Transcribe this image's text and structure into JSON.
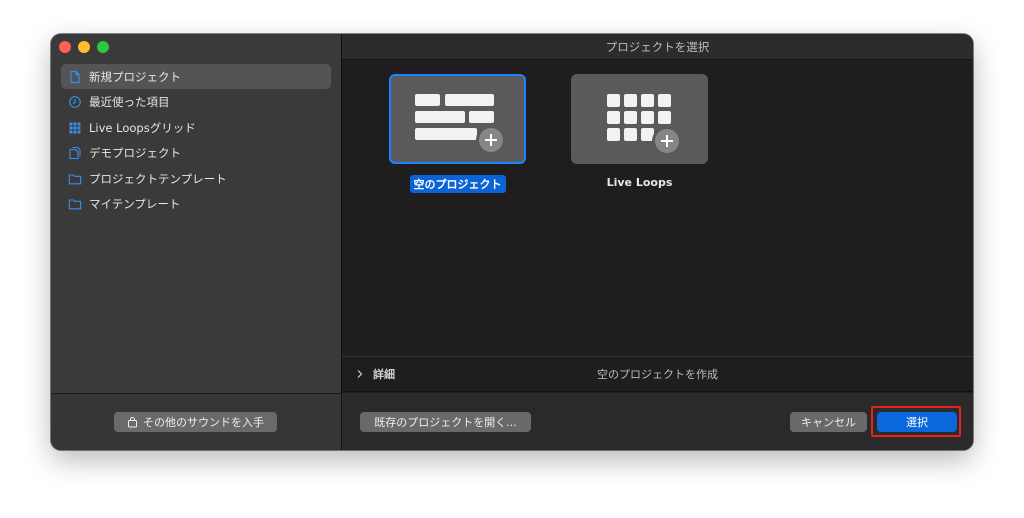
{
  "window": {
    "title": "プロジェクトを選択"
  },
  "sidebar": {
    "items": [
      {
        "label": "新規プロジェクト",
        "icon": "document-icon"
      },
      {
        "label": "最近使った項目",
        "icon": "clock-icon"
      },
      {
        "label": "Live Loopsグリッド",
        "icon": "grid-icon"
      },
      {
        "label": "デモプロジェクト",
        "icon": "documents-icon"
      },
      {
        "label": "プロジェクトテンプレート",
        "icon": "folder-icon"
      },
      {
        "label": "マイテンプレート",
        "icon": "folder-icon"
      }
    ],
    "get_sounds_label": "その他のサウンドを入手"
  },
  "templates": [
    {
      "label": "空のプロジェクト",
      "selected": true
    },
    {
      "label": "Live Loops",
      "selected": false
    }
  ],
  "details": {
    "label": "詳細",
    "info": "空のプロジェクトを作成"
  },
  "footer": {
    "open_existing_label": "既存のプロジェクトを開く...",
    "cancel_label": "キャンセル",
    "choose_label": "選択"
  },
  "colors": {
    "accent": "#0a67dc",
    "highlight_outline": "#e8231b"
  }
}
